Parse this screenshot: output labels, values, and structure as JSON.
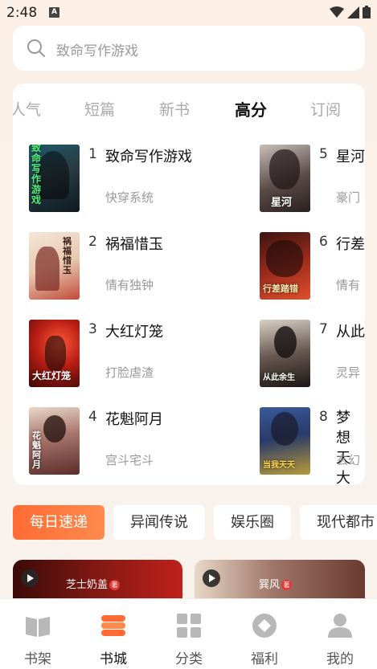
{
  "status": {
    "time": "2:48",
    "notif_letter": "A"
  },
  "search": {
    "placeholder": "致命写作游戏"
  },
  "rank_tabs": [
    "人气",
    "短篇",
    "新书",
    "高分",
    "订阅"
  ],
  "active_tab": "高分",
  "books": [
    {
      "rank": "1",
      "title": "致命写作游戏",
      "tag": "快穿系统",
      "cover_text": "致命写作游戏"
    },
    {
      "rank": "2",
      "title": "祸福惜玉",
      "tag": "情有独钟",
      "cover_text": "祸福惜玉"
    },
    {
      "rank": "3",
      "title": "大红灯笼",
      "tag": "打脸虐渣",
      "cover_text": "大红灯笼"
    },
    {
      "rank": "4",
      "title": "花魁阿月",
      "tag": "宫斗宅斗",
      "cover_text": "花魁阿月"
    },
    {
      "rank": "5",
      "title": "星河",
      "tag": "豪门",
      "cover_text": "星河"
    },
    {
      "rank": "6",
      "title": "行差",
      "tag": "情有",
      "cover_text": "行差踏错"
    },
    {
      "rank": "7",
      "title": "从此",
      "tag": "灵异",
      "cover_text": "从此余生"
    },
    {
      "rank": "8",
      "title": "梦想天大",
      "tag": "玄幻",
      "cover_text": "当我天天"
    }
  ],
  "chips": [
    "每日速递",
    "异闻传说",
    "娱乐圈",
    "现代都市"
  ],
  "banners": [
    {
      "author": "芝士奶盖",
      "badge": "著"
    },
    {
      "author": "巽风",
      "badge": "著"
    }
  ],
  "nav": [
    {
      "label": "书架",
      "icon": "bookshelf-icon"
    },
    {
      "label": "书城",
      "icon": "bookstore-icon"
    },
    {
      "label": "分类",
      "icon": "category-icon"
    },
    {
      "label": "福利",
      "icon": "welfare-icon"
    },
    {
      "label": "我的",
      "icon": "profile-icon"
    }
  ],
  "colors": {
    "accent": "#ff6b35",
    "background": "#fbefe6",
    "muted": "#999999"
  }
}
